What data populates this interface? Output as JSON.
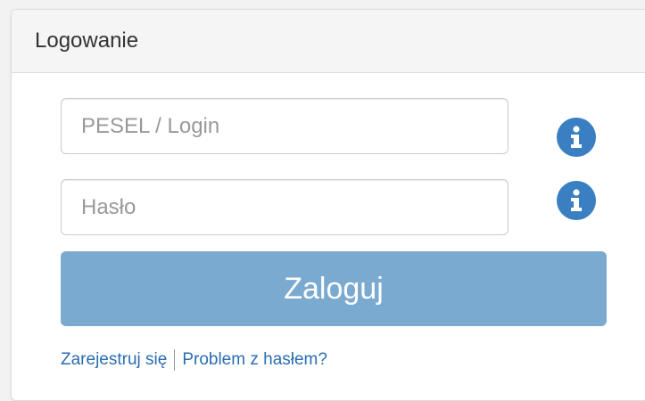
{
  "panel": {
    "title": "Logowanie"
  },
  "form": {
    "login": {
      "value": "",
      "placeholder": "PESEL / Login"
    },
    "password": {
      "value": "",
      "placeholder": "Hasło"
    },
    "submit_label": "Zaloguj"
  },
  "links": {
    "register": "Zarejestruj się",
    "password_problem": "Problem z hasłem?"
  },
  "icons": {
    "login_info": "info-icon",
    "password_info": "info-icon"
  },
  "colors": {
    "primary_button": "#7aaad0",
    "info_icon": "#3a7fc2",
    "link": "#2a6db0"
  }
}
